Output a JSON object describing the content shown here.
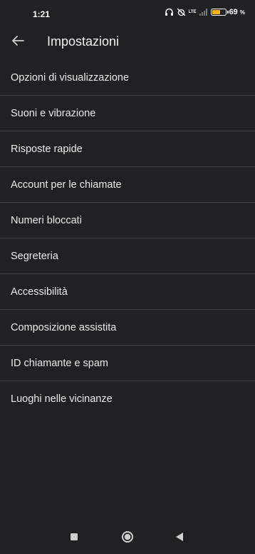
{
  "status_bar": {
    "time": "1:21",
    "network_label": "LTE",
    "battery_percent": "69",
    "battery_unit": "%",
    "battery_level": 0.69,
    "battery_color": "#f4b400"
  },
  "app_bar": {
    "title": "Impostazioni",
    "back_icon": "arrow-back-icon"
  },
  "settings": {
    "items": [
      {
        "label": "Opzioni di visualizzazione"
      },
      {
        "label": "Suoni e vibrazione"
      },
      {
        "label": "Risposte rapide"
      },
      {
        "label": "Account per le chiamate"
      },
      {
        "label": "Numeri bloccati"
      },
      {
        "label": "Segreteria"
      },
      {
        "label": "Accessibilità"
      },
      {
        "label": "Composizione assistita"
      },
      {
        "label": "ID chiamante e spam"
      },
      {
        "label": "Luoghi nelle vicinanze"
      }
    ]
  },
  "nav_bar": {
    "recents_icon": "square-icon",
    "home_icon": "circle-icon",
    "back_icon": "triangle-back-icon"
  },
  "colors": {
    "background": "#212124",
    "divider": "#3d3d40",
    "text": "#eaeaea"
  }
}
